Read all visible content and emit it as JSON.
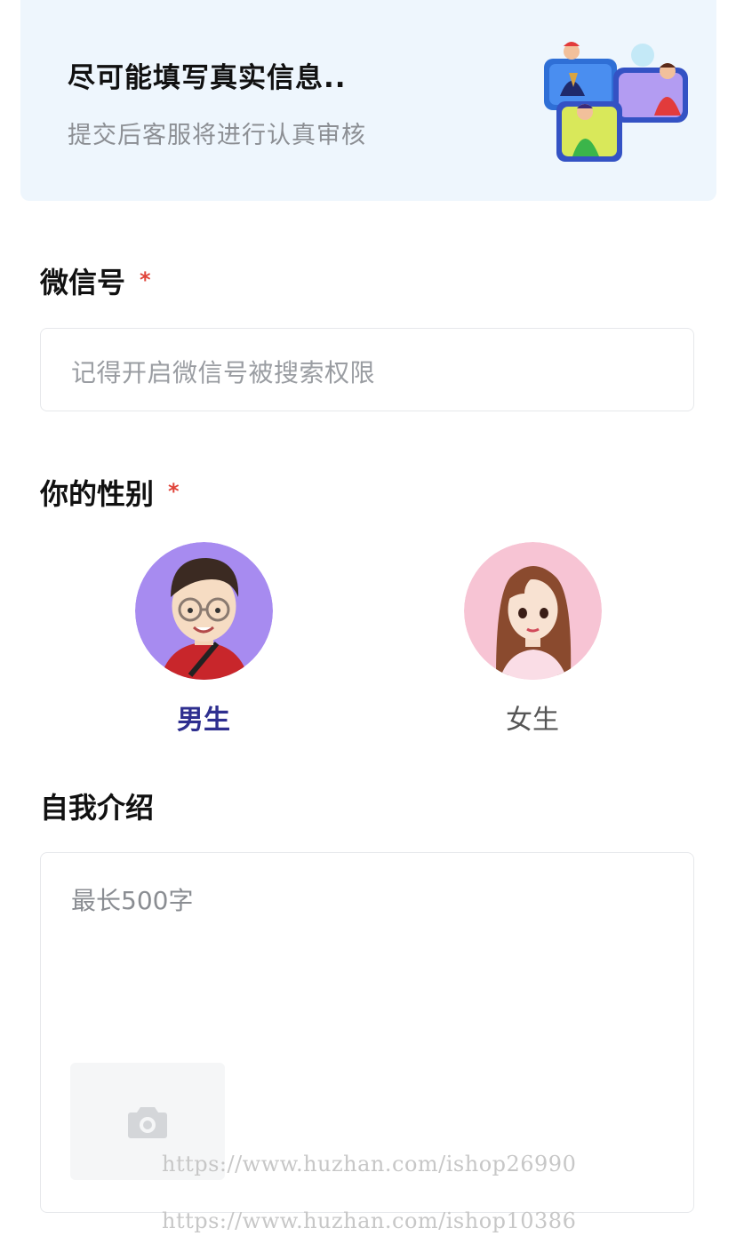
{
  "banner": {
    "title": "尽可能填写真实信息..",
    "subtitle": "提交后客服将进行认真审核",
    "illustration_icon": "people-chatting-illustration"
  },
  "wechat": {
    "label": "微信号",
    "required_mark": "*",
    "placeholder": "记得开启微信号被搜索权限"
  },
  "gender": {
    "label": "你的性别",
    "required_mark": "*",
    "options": [
      {
        "label": "男生",
        "selected": true,
        "avatar_bg": "#a78bf0"
      },
      {
        "label": "女生",
        "selected": false,
        "avatar_bg": "#f7c4d4"
      }
    ]
  },
  "intro": {
    "label": "自我介绍",
    "placeholder": "最长500字",
    "upload_icon": "camera-icon"
  },
  "watermarks": [
    "https://www.huzhan.com/ishop26990",
    "https://www.huzhan.com/ishop10386"
  ],
  "colors": {
    "accent": "#2e2f8f",
    "required": "#e0443a",
    "banner_bg": "#eef6fd"
  }
}
